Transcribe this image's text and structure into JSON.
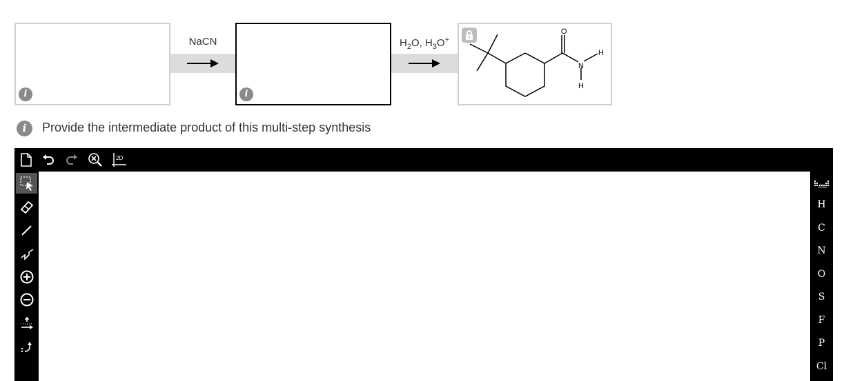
{
  "reaction": {
    "step1_reagent": "NaCN",
    "step2_reagent_html": "H<sub>2</sub>O, H<sub>3</sub>O<sup>+</sup>",
    "step2_reagent": "H2O, H3O+",
    "product_atoms": {
      "o": "O",
      "n": "N",
      "h1": "H",
      "h2": "H"
    }
  },
  "prompt": {
    "text": "Provide the intermediate product of this multi-step synthesis"
  },
  "editor": {
    "top_tools": [
      "new-document-icon",
      "undo-icon",
      "redo-icon",
      "zoom-clear-icon",
      "2d-clean-icon"
    ],
    "left_tools": [
      "select-icon",
      "eraser-icon",
      "single-bond-icon",
      "chain-icon",
      "charge-plus-icon",
      "charge-minus-icon",
      "reaction-arrow-icon",
      "electron-push-icon"
    ],
    "selected_tool": "select-icon",
    "periodic_table_icon": "periodic-table-icon",
    "elements": [
      "H",
      "C",
      "N",
      "O",
      "S",
      "F",
      "P",
      "Cl"
    ],
    "top_badge": "2D"
  }
}
